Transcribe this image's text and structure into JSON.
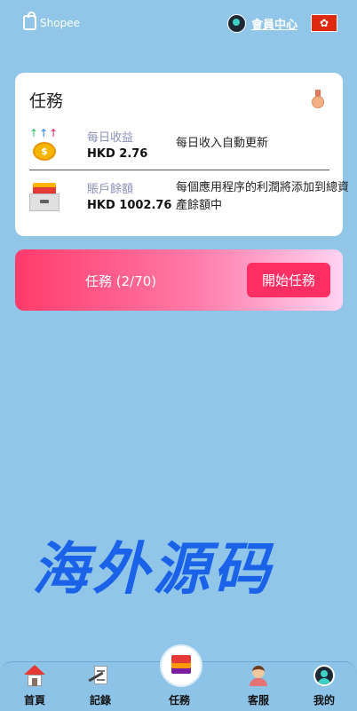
{
  "header": {
    "brand": "Shopee",
    "member_center": "會員中心",
    "flag_symbol": "✿"
  },
  "task_card": {
    "title": "任務",
    "daily": {
      "label": "每日收益",
      "amount": "HKD 2.76",
      "description": "每日收入自動更新"
    },
    "balance": {
      "label": "賬戶餘額",
      "amount": "HKD 1002.76",
      "description": "每個應用程序的利潤將添加到總資產餘額中"
    }
  },
  "banner": {
    "progress_text": "任務 (2/70)",
    "start_button": "開始任務"
  },
  "watermark": "海外源码",
  "nav": {
    "items": [
      {
        "label": "首頁",
        "icon": "home-icon"
      },
      {
        "label": "記錄",
        "icon": "record-icon"
      },
      {
        "label": "任務",
        "icon": "layers-icon"
      },
      {
        "label": "客服",
        "icon": "customer-service-icon"
      },
      {
        "label": "我的",
        "icon": "profile-icon"
      }
    ]
  },
  "colors": {
    "background": "#91c6e8",
    "accent": "#ff2e63"
  }
}
